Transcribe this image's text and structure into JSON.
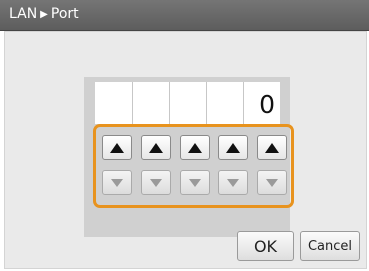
{
  "titlebar": {
    "section": "LAN",
    "separator_icon": "right-triangle-icon",
    "page": "Port"
  },
  "port_editor": {
    "digits": [
      "",
      "",
      "",
      "",
      "0"
    ],
    "up_icon": "up-triangle-icon",
    "down_icon": "down-triangle-icon",
    "highlight_color": "#e8931e"
  },
  "buttons": {
    "ok_label": "OK",
    "cancel_label": "Cancel"
  }
}
